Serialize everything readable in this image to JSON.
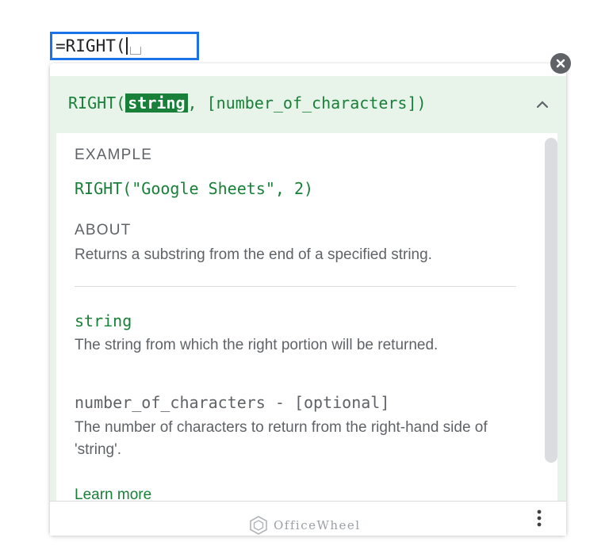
{
  "formula_bar": {
    "value": "=RIGHT("
  },
  "signature": {
    "function_name": "RIGHT(",
    "active_argument": "string",
    "rest": ", [number_of_characters])"
  },
  "sections": {
    "example_label": "EXAMPLE",
    "example_code": "RIGHT(\"Google Sheets\", 2)",
    "about_label": "ABOUT",
    "about_text": "Returns a substring from the end of a specified string."
  },
  "arguments": [
    {
      "name": "string",
      "description": "The string from which the right portion will be returned."
    },
    {
      "name": "number_of_characters - [optional]",
      "description": "The number of characters to return from the right-hand side of 'string'."
    }
  ],
  "learn_more": "Learn more",
  "watermark": "OfficeWheel",
  "icons": {
    "close": "close-circle-icon",
    "collapse": "chevron-up-icon",
    "more": "more-vert-icon",
    "logo": "officewheel-logo-icon"
  },
  "colors": {
    "accent_green": "#188038",
    "header_bg": "#e8f3ea",
    "cell_border": "#1a73e8",
    "text_gray": "#5f6368"
  }
}
